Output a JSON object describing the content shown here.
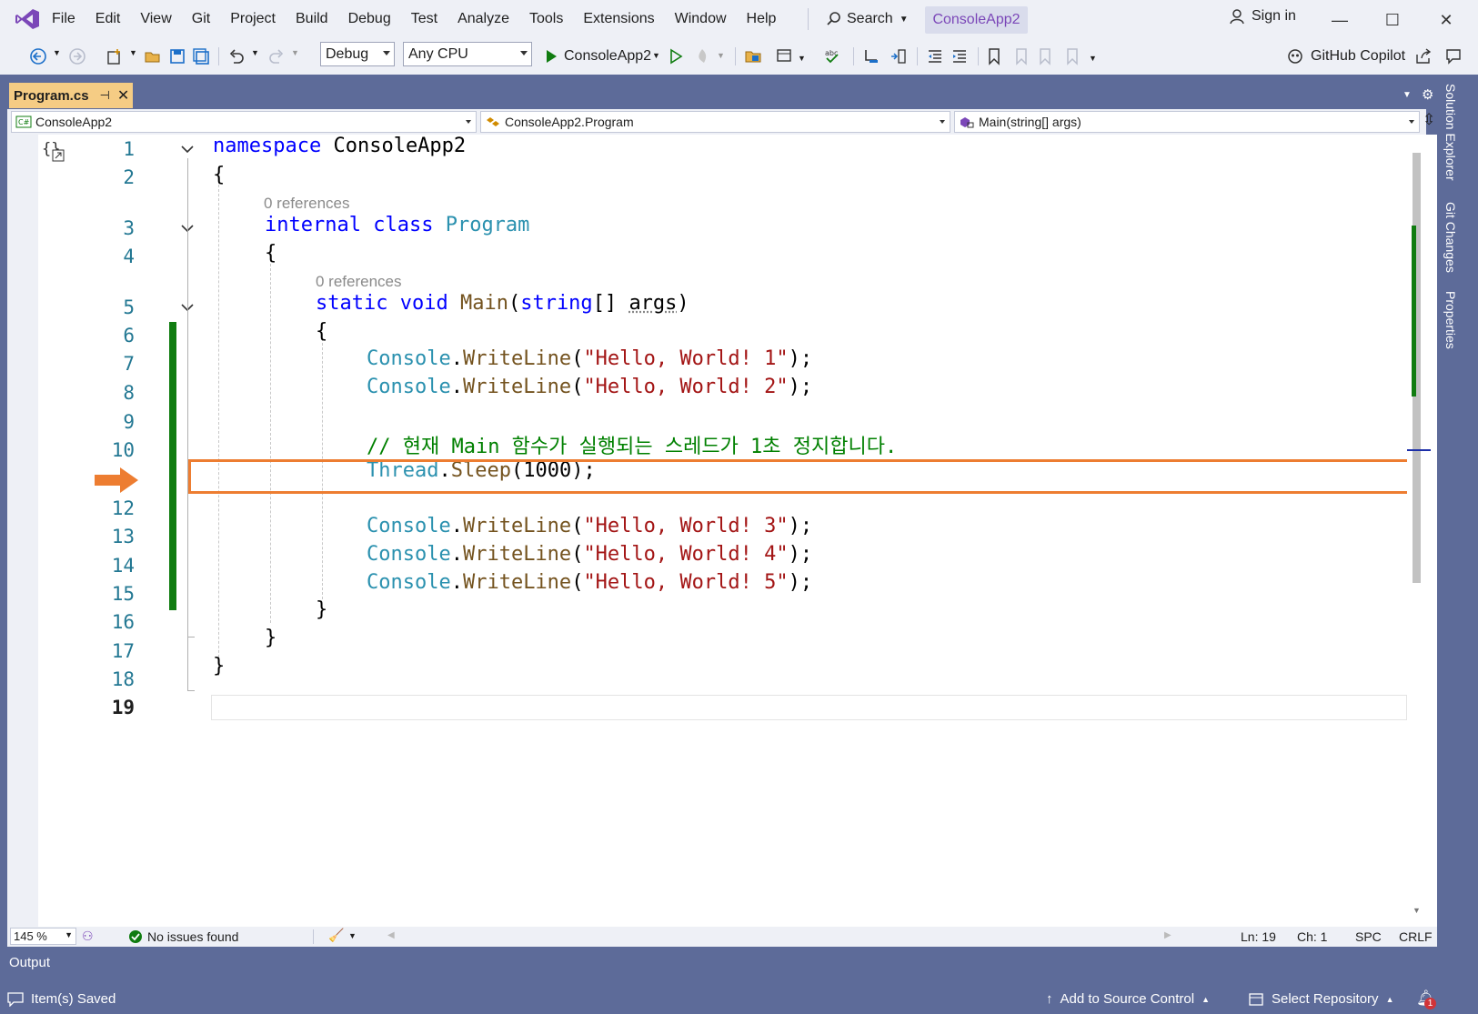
{
  "menu": [
    "File",
    "Edit",
    "View",
    "Git",
    "Project",
    "Build",
    "Debug",
    "Test",
    "Analyze",
    "Tools",
    "Extensions",
    "Window",
    "Help"
  ],
  "search_label": "Search",
  "solution_name": "ConsoleApp2",
  "sign_in": "Sign in",
  "toolbar": {
    "config": "Debug",
    "platform": "Any CPU",
    "start_target": "ConsoleApp2",
    "copilot": "GitHub Copilot"
  },
  "doc_tab": {
    "label": "Program.cs"
  },
  "navbar": {
    "project": "ConsoleApp2",
    "type": "ConsoleApp2.Program",
    "member": "Main(string[] args)"
  },
  "code": {
    "l1": {
      "kw": "namespace",
      "name": "ConsoleApp2"
    },
    "l2": "{",
    "refs_class": "0 references",
    "l3": {
      "kw1": "internal",
      "kw2": "class",
      "type": "Program"
    },
    "l4": "{",
    "refs_main": "0 references",
    "l5": {
      "kw1": "static",
      "kw2": "void",
      "method": "Main",
      "open": "(",
      "kw3": "string",
      "mid": "[] ",
      "param": "args",
      "close": ")"
    },
    "l6": "{",
    "console": "Console",
    "writeline": "WriteLine",
    "str1": "\"Hello, World! 1\"",
    "str2": "\"Hello, World! 2\"",
    "str3": "\"Hello, World! 3\"",
    "str4": "\"Hello, World! 4\"",
    "str5": "\"Hello, World! 5\"",
    "comment": "// 현재 Main 함수가 실행되는 스레드가 1초 정지합니다.",
    "thread": "Thread",
    "sleep": "Sleep",
    "sleep_args": "(1000);",
    "close_brace": "}"
  },
  "line_numbers": [
    "1",
    "2",
    "3",
    "4",
    "5",
    "6",
    "7",
    "8",
    "9",
    "10",
    "12",
    "13",
    "14",
    "15",
    "16",
    "17",
    "18",
    "19"
  ],
  "side_tabs": [
    "Solution Explorer",
    "Git Changes",
    "Properties"
  ],
  "editor_status": {
    "zoom": "145 %",
    "issues": "No issues found",
    "ln": "Ln: 19",
    "ch": "Ch: 1",
    "spc": "SPC",
    "crlf": "CRLF"
  },
  "output_label": "Output",
  "statusbar": {
    "saved": "Item(s) Saved",
    "source_control": "Add to Source Control",
    "repo": "Select Repository",
    "notifications": "1"
  },
  "colors": {
    "accent": "#5d6b99",
    "highlight": "#ed7d31",
    "change": "#107c10",
    "brand": "#7b47b8"
  }
}
